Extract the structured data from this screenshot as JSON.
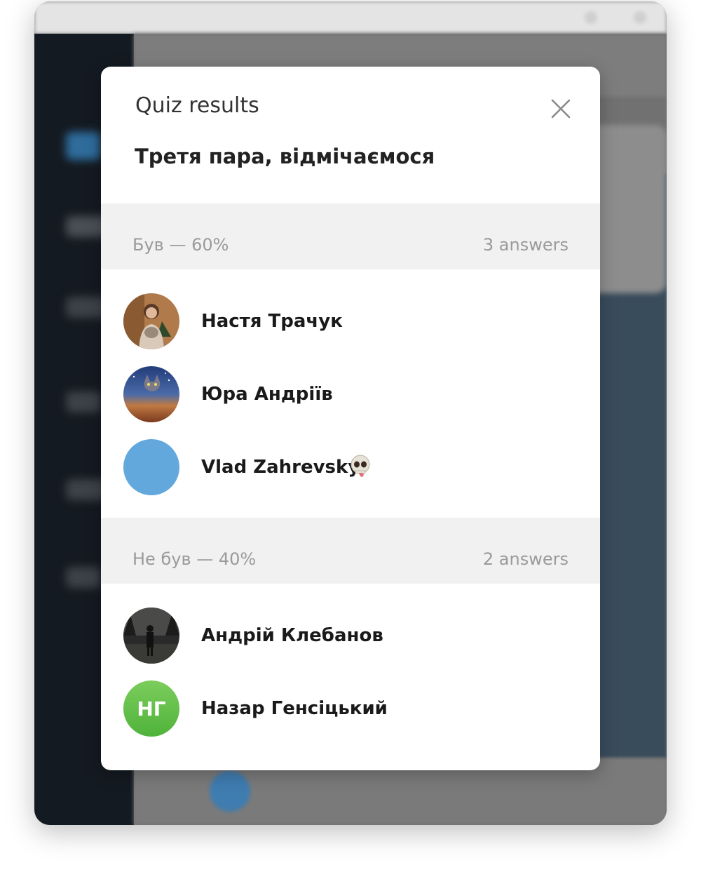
{
  "dialog": {
    "title": "Quiz results",
    "question": "Третя пара, відмічаємося"
  },
  "options": [
    {
      "label": "Був — 60%",
      "count": "3 answers",
      "voters": [
        {
          "name": "Настя Трачук",
          "avatar": "photo-woman-with-cat"
        },
        {
          "name": "Юра Андріїв",
          "avatar": "photo-cat-in-space"
        },
        {
          "name": "Vlad Zahrevsky",
          "avatar": "blue-circle",
          "badge_icon": "skull-tongue-emoji-icon"
        }
      ]
    },
    {
      "label": "Не був — 40%",
      "count": "2 answers",
      "voters": [
        {
          "name": "Андрій Клебанов",
          "avatar": "photo-person-in-forest"
        },
        {
          "name": "Назар Генсіцький",
          "avatar": "initials",
          "initials": "НГ"
        }
      ]
    }
  ],
  "colors": {
    "avatar_blue": "#62a8dc",
    "avatar_green": "#5cbe45",
    "section_bg": "#f1f1f1",
    "muted_text": "#9a9a9a"
  }
}
